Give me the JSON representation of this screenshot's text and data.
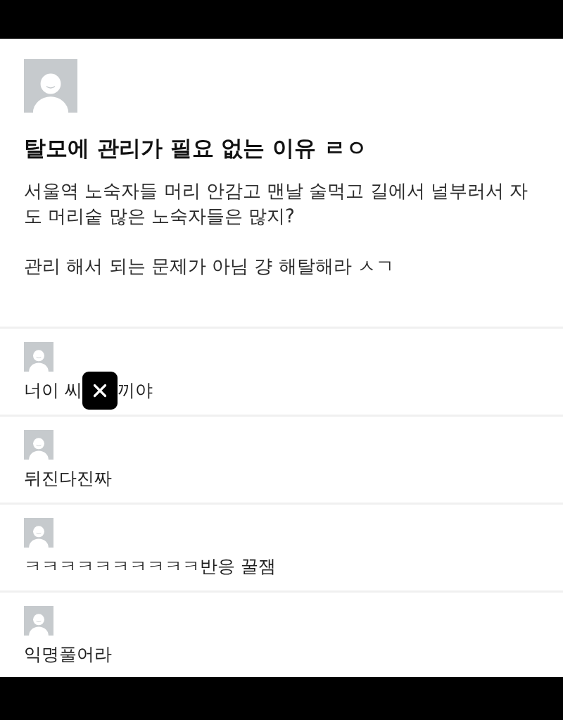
{
  "post": {
    "title": "탈모에 관리가 필요 없는 이유 ㄹㅇ",
    "body": [
      "서울역 노숙자들 머리 안감고 맨날 술먹고 길에서 널부러서 자도 머리숱 많은 노숙자들은 많지?",
      "관리 해서 되는 문제가 아님 걍 해탈해라 ㅅㄱ"
    ]
  },
  "comments": [
    {
      "kind": "censored",
      "parts": [
        "너이 씨",
        "끼야"
      ]
    },
    {
      "kind": "plain",
      "text": "뒤진다진짜"
    },
    {
      "kind": "plain",
      "text": "ㅋㅋㅋㅋㅋㅋㅋㅋㅋㅋ반응 꿀잼"
    },
    {
      "kind": "plain",
      "text": "익명풀어라"
    }
  ]
}
